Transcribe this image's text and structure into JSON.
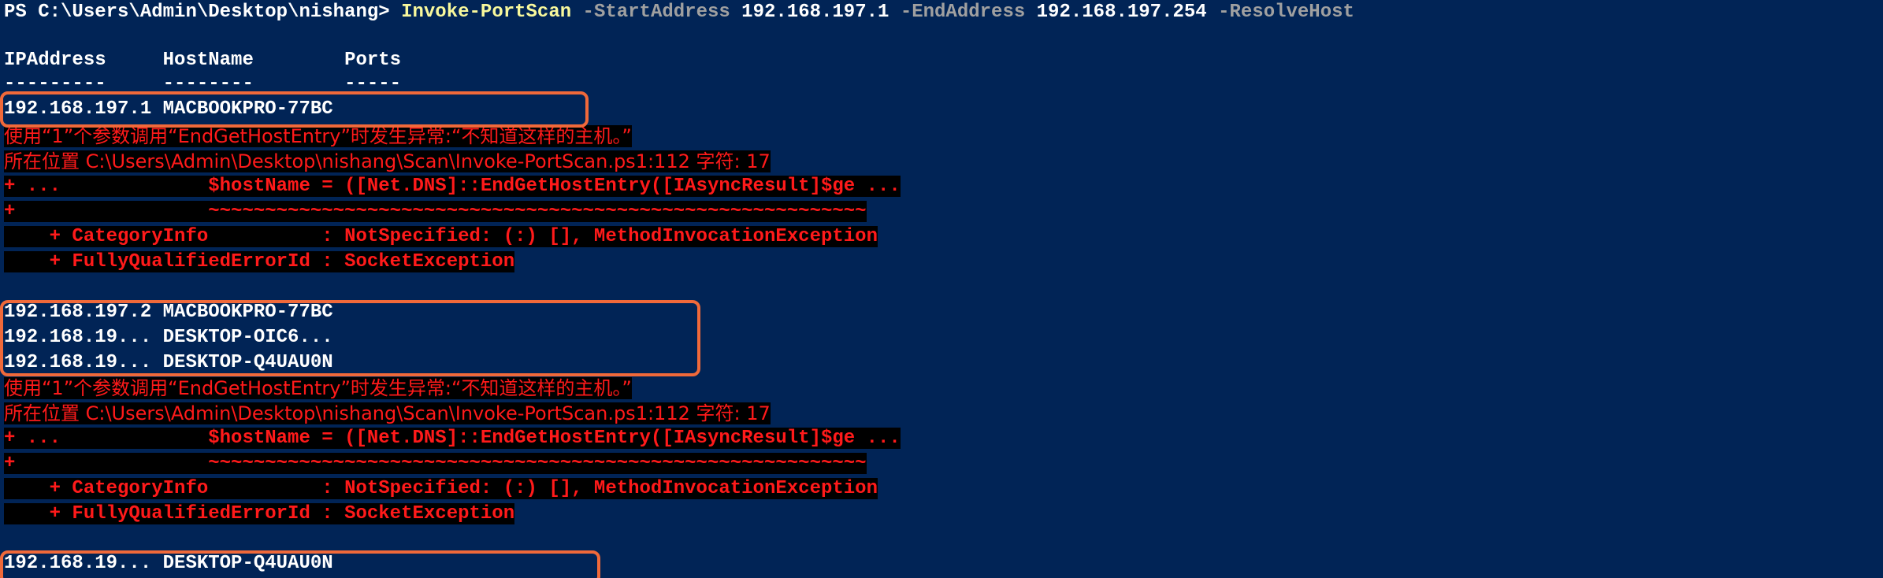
{
  "prompt": {
    "ps_path": "PS C:\\Users\\Admin\\Desktop\\nishang> ",
    "command": "Invoke-PortScan",
    "param_start": " -StartAddress",
    "start_value": " 192.168.197.1",
    "param_end": " -EndAddress",
    "end_value": " 192.168.197.254",
    "param_resolve": " -ResolveHost"
  },
  "table": {
    "headers": "IPAddress     HostName        Ports",
    "underline": "---------     --------        -----"
  },
  "rows": {
    "r1": "192.168.197.1 MACBOOKPRO-77BC",
    "r2": "192.168.197.2 MACBOOKPRO-77BC",
    "r3": "192.168.19... DESKTOP-OIC6...",
    "r4": "192.168.19... DESKTOP-Q4UAU0N",
    "r5": "192.168.19... DESKTOP-Q4UAU0N"
  },
  "error": {
    "line1": "使用“1”个参数调用“EndGetHostEntry”时发生异常:“不知道这样的主机。”",
    "line2": "所在位置 C:\\Users\\Admin\\Desktop\\nishang\\Scan\\Invoke-PortScan.ps1:112 字符: 17",
    "line3": "+ ...             $hostName = ([Net.DNS]::EndGetHostEntry([IAsyncResult]$ge ...",
    "line4": "+                 ~~~~~~~~~~~~~~~~~~~~~~~~~~~~~~~~~~~~~~~~~~~~~~~~~~~~~~~~~~",
    "line5": "    + CategoryInfo          : NotSpecified: (:) [], MethodInvocationException",
    "line6": "    + FullyQualifiedErrorId : SocketException"
  },
  "colors": {
    "background": "#012456",
    "command": "#f8f89c",
    "parameter": "#a0a0a0",
    "error_text": "#ff1a1a",
    "error_bg": "#000000",
    "highlight_box": "#f0693a"
  }
}
